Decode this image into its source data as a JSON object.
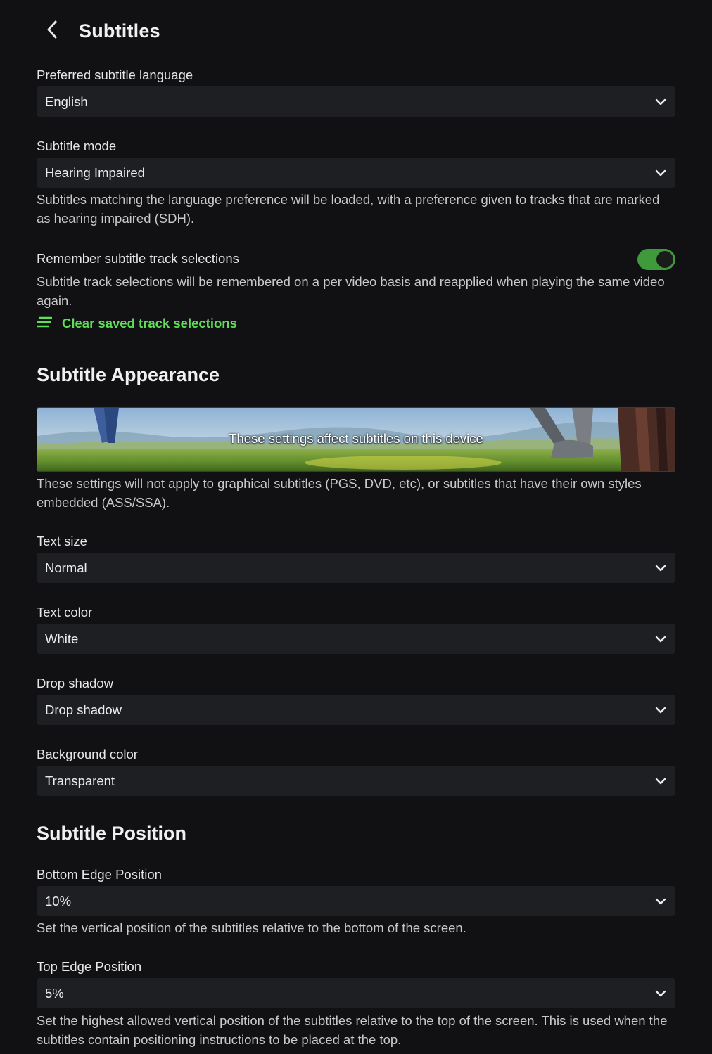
{
  "header": {
    "title": "Subtitles",
    "back_icon": "chevron-left-icon"
  },
  "language": {
    "label": "Preferred subtitle language",
    "value": "English"
  },
  "mode": {
    "label": "Subtitle mode",
    "value": "Hearing Impaired",
    "description": "Subtitles matching the language preference will be loaded, with a preference given to tracks that are marked as hearing impaired (SDH)."
  },
  "remember": {
    "label": "Remember subtitle track selections",
    "enabled": true,
    "description": "Subtitle track selections will be remembered on a per video basis and reapplied when playing the same video again.",
    "clear_label": "Clear saved track selections",
    "clear_icon": "clear-list-icon"
  },
  "appearance": {
    "title": "Subtitle Appearance",
    "preview_text": "These settings affect subtitles on this device",
    "note": "These settings will not apply to graphical subtitles (PGS, DVD, etc), or subtitles that have their own styles embedded (ASS/SSA).",
    "text_size": {
      "label": "Text size",
      "value": "Normal"
    },
    "text_color": {
      "label": "Text color",
      "value": "White"
    },
    "drop_shadow": {
      "label": "Drop shadow",
      "value": "Drop shadow"
    },
    "background_color": {
      "label": "Background color",
      "value": "Transparent"
    }
  },
  "position": {
    "title": "Subtitle Position",
    "bottom": {
      "label": "Bottom Edge Position",
      "value": "10%",
      "description": "Set the vertical position of the subtitles relative to the bottom of the screen."
    },
    "top": {
      "label": "Top Edge Position",
      "value": "5%",
      "description": "Set the highest allowed vertical position of the subtitles relative to the top of the screen. This is used when the subtitles contain positioning instructions to be placed at the top."
    }
  },
  "colors": {
    "accent": "#5fdf57",
    "toggle_on": "#3f9a3c",
    "background": "#111113",
    "field": "#1e1f22"
  }
}
